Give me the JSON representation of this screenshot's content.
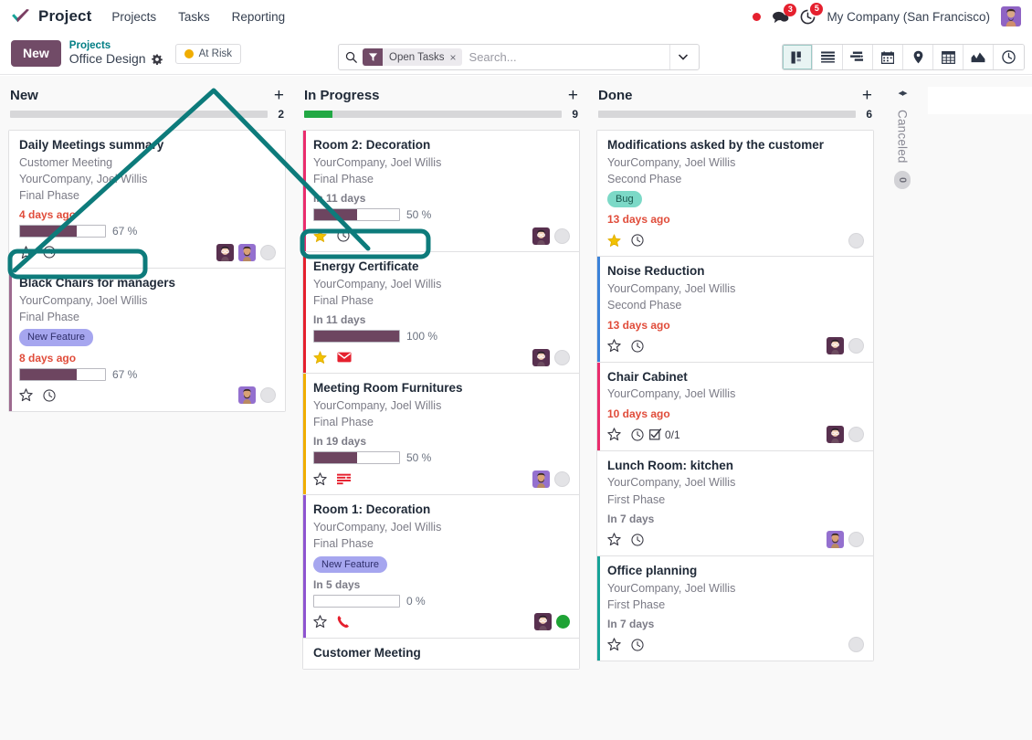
{
  "navbar": {
    "brand": "Project",
    "logo_icon": "check-logo-icon",
    "links": [
      "Projects",
      "Tasks",
      "Reporting"
    ],
    "status_dot_icon": "red-status-dot-icon",
    "messages_icon": "messages-icon",
    "messages_count": "3",
    "activities_icon": "activities-clock-icon",
    "activities_count": "5",
    "company": "My Company (San Francisco)",
    "avatar_icon": "user-avatar"
  },
  "control_panel": {
    "new_label": "New",
    "breadcrumb_parent": "Projects",
    "breadcrumb_current": "Office Design",
    "gear_icon": "gear-icon",
    "risk_label": "At Risk",
    "risk_color": "#f0ad00"
  },
  "search": {
    "icon": "search-icon",
    "facet_icon": "filter-icon",
    "facet_label": "Open Tasks",
    "facet_remove": "×",
    "placeholder": "Search...",
    "caret_icon": "chevron-down-icon"
  },
  "view_switcher": {
    "views": [
      {
        "name": "kanban",
        "icon": "kanban-icon",
        "active": true
      },
      {
        "name": "list",
        "icon": "list-icon",
        "active": false
      },
      {
        "name": "gantt",
        "icon": "gantt-icon",
        "active": false
      },
      {
        "name": "calendar",
        "icon": "calendar-icon",
        "active": false
      },
      {
        "name": "map",
        "icon": "map-pin-icon",
        "active": false
      },
      {
        "name": "pivot",
        "icon": "pivot-table-icon",
        "active": false
      },
      {
        "name": "graph",
        "icon": "graph-icon",
        "active": false
      },
      {
        "name": "activity",
        "icon": "activity-clock-icon",
        "active": false
      }
    ]
  },
  "columns": [
    {
      "title": "New",
      "count": "2",
      "add_icon": "plus-icon",
      "meter_green_pct": 0,
      "cards": [
        {
          "title": "Daily Meetings summary",
          "lines": [
            "Customer Meeting",
            "YourCompany, Joel Willis",
            "Final Phase"
          ],
          "tag": null,
          "date": "4 days ago",
          "date_color": "#e04c3a",
          "progress": "67 %",
          "progress_pct": 67,
          "stripe": null,
          "star": "star-outline-icon",
          "star_active": false,
          "activity_icon": "clock-icon",
          "extra_icon": null,
          "checklist": null,
          "avatars": [
            "avatar-glasses",
            "avatar-beard"
          ],
          "empty_avatar": true,
          "green_dot": false
        },
        {
          "title": "Black Chairs for managers",
          "lines": [
            "YourCompany, Joel Willis",
            "Final Phase"
          ],
          "tag": {
            "label": "New Feature",
            "bg": "#a6a6ef",
            "color": "#2f2f6b"
          },
          "date": "8 days ago",
          "date_color": "#e04c3a",
          "progress": "67 %",
          "progress_pct": 67,
          "stripe": "#9d6a8f",
          "star": "star-outline-icon",
          "star_active": false,
          "activity_icon": "clock-icon",
          "extra_icon": null,
          "checklist": null,
          "avatars": [
            "avatar-beard"
          ],
          "empty_avatar": true,
          "green_dot": false
        }
      ]
    },
    {
      "title": "In Progress",
      "count": "9",
      "add_icon": "plus-icon",
      "meter_green_pct": 11,
      "cards": [
        {
          "title": "Room 2: Decoration",
          "lines": [
            "YourCompany, Joel Willis",
            "Final Phase"
          ],
          "tag": null,
          "date": "In 11 days",
          "date_color": "#7b7b86",
          "progress": "50 %",
          "progress_pct": 50,
          "stripe": "#ea2d6d",
          "star": "star-filled-icon",
          "star_active": true,
          "activity_icon": "clock-icon",
          "extra_icon": null,
          "checklist": null,
          "avatars": [
            "avatar-glasses"
          ],
          "empty_avatar": true,
          "green_dot": false
        },
        {
          "title": "Energy Certificate",
          "lines": [
            "YourCompany, Joel Willis",
            "Final Phase"
          ],
          "tag": null,
          "date": "In 11 days",
          "date_color": "#7b7b86",
          "progress": "100 %",
          "progress_pct": 100,
          "stripe": "#e5202e",
          "star": "star-filled-icon",
          "star_active": true,
          "activity_icon": null,
          "extra_icon": "email-icon",
          "checklist": null,
          "avatars": [
            "avatar-glasses"
          ],
          "empty_avatar": true,
          "green_dot": false
        },
        {
          "title": "Meeting Room Furnitures",
          "lines": [
            "YourCompany, Joel Willis",
            "Final Phase"
          ],
          "tag": null,
          "date": "In 19 days",
          "date_color": "#7b7b86",
          "progress": "50 %",
          "progress_pct": 50,
          "stripe": "#f0ad00",
          "star": "star-outline-icon",
          "star_active": false,
          "activity_icon": null,
          "extra_icon": "todo-list-icon",
          "checklist": null,
          "avatars": [
            "avatar-beard"
          ],
          "empty_avatar": true,
          "green_dot": false
        },
        {
          "title": "Room 1: Decoration",
          "lines": [
            "YourCompany, Joel Willis",
            "Final Phase"
          ],
          "tag": {
            "label": "New Feature",
            "bg": "#a6a6ef",
            "color": "#2f2f6b"
          },
          "date": "In 5 days",
          "date_color": "#7b7b86",
          "progress": "0 %",
          "progress_pct": 0,
          "stripe": "#8e54d0",
          "star": "star-outline-icon",
          "star_active": false,
          "activity_icon": null,
          "extra_icon": "phone-icon",
          "checklist": null,
          "avatars": [
            "avatar-glasses"
          ],
          "empty_avatar": false,
          "green_dot": true
        },
        {
          "title": "Customer Meeting",
          "lines": [],
          "tag": null,
          "date": null,
          "date_color": "#7b7b86",
          "progress": null,
          "progress_pct": 0,
          "stripe": null,
          "star": null,
          "star_active": false,
          "activity_icon": null,
          "extra_icon": null,
          "checklist": null,
          "avatars": [],
          "empty_avatar": false,
          "green_dot": false
        }
      ]
    },
    {
      "title": "Done",
      "count": "6",
      "add_icon": "plus-icon",
      "meter_green_pct": 0,
      "cards": [
        {
          "title": "Modifications asked by the customer",
          "lines": [
            "YourCompany, Joel Willis",
            "Second Phase"
          ],
          "tag": {
            "label": "Bug",
            "bg": "#7cd9c7",
            "color": "#17564c"
          },
          "date": "13 days ago",
          "date_color": "#e04c3a",
          "progress": null,
          "progress_pct": 0,
          "stripe": null,
          "star": "star-filled-icon",
          "star_active": true,
          "activity_icon": "clock-icon",
          "extra_icon": null,
          "checklist": null,
          "avatars": [],
          "empty_avatar": true,
          "green_dot": false
        },
        {
          "title": "Noise Reduction",
          "lines": [
            "YourCompany, Joel Willis",
            "Second Phase"
          ],
          "tag": null,
          "date": "13 days ago",
          "date_color": "#e04c3a",
          "progress": null,
          "progress_pct": 0,
          "stripe": "#3b82d9",
          "star": "star-outline-icon",
          "star_active": false,
          "activity_icon": "clock-icon",
          "extra_icon": null,
          "checklist": null,
          "avatars": [
            "avatar-glasses"
          ],
          "empty_avatar": true,
          "green_dot": false
        },
        {
          "title": "Chair Cabinet",
          "lines": [
            "YourCompany, Joel Willis"
          ],
          "tag": null,
          "date": "10 days ago",
          "date_color": "#e04c3a",
          "progress": null,
          "progress_pct": 0,
          "stripe": "#ea2d6d",
          "star": "star-outline-icon",
          "star_active": false,
          "activity_icon": "clock-icon",
          "extra_icon": null,
          "checklist": "0/1",
          "avatars": [
            "avatar-glasses"
          ],
          "empty_avatar": true,
          "green_dot": false
        },
        {
          "title": "Lunch Room: kitchen",
          "lines": [
            "YourCompany, Joel Willis",
            "First Phase"
          ],
          "tag": null,
          "date": "In 7 days",
          "date_color": "#7b7b86",
          "progress": null,
          "progress_pct": 0,
          "stripe": null,
          "star": "star-outline-icon",
          "star_active": false,
          "activity_icon": "clock-icon",
          "extra_icon": null,
          "checklist": null,
          "avatars": [
            "avatar-beard"
          ],
          "empty_avatar": true,
          "green_dot": false
        },
        {
          "title": "Office planning",
          "lines": [
            "YourCompany, Joel Willis",
            "First Phase"
          ],
          "tag": null,
          "date": "In 7 days",
          "date_color": "#7b7b86",
          "progress": null,
          "progress_pct": 0,
          "stripe": "#17a398",
          "star": "star-outline-icon",
          "star_active": false,
          "activity_icon": "clock-icon",
          "extra_icon": null,
          "checklist": null,
          "avatars": [],
          "empty_avatar": true,
          "green_dot": false
        }
      ]
    }
  ],
  "collapsed_column": {
    "toggle_icon": "expand-collapse-icon",
    "label": "Canceled",
    "count": "0"
  },
  "add_column": {
    "plus_icon": "plus-icon"
  },
  "annotation": {
    "color": "#0d7b7b"
  }
}
